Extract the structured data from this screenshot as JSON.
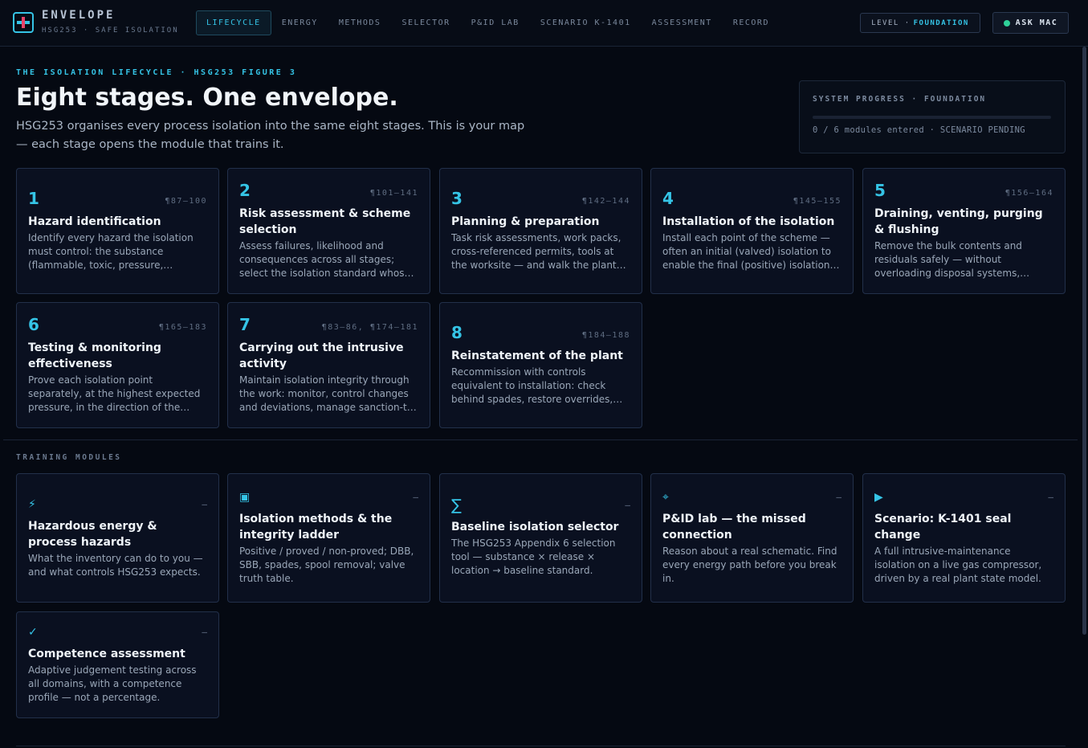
{
  "header": {
    "brand": "ENVELOPE",
    "subtitle": "HSG253 · SAFE ISOLATION",
    "nav": [
      {
        "label": "LIFECYCLE",
        "active": true
      },
      {
        "label": "ENERGY"
      },
      {
        "label": "METHODS"
      },
      {
        "label": "SELECTOR"
      },
      {
        "label": "P&ID LAB"
      },
      {
        "label": "SCENARIO K-1401"
      },
      {
        "label": "ASSESSMENT"
      },
      {
        "label": "RECORD"
      }
    ],
    "level_prefix": "LEVEL ·",
    "level_value": "FOUNDATION",
    "ask_label": "ASK MAC"
  },
  "hero": {
    "eyebrow": "THE ISOLATION LIFECYCLE · HSG253 FIGURE 3",
    "title": "Eight stages. One envelope.",
    "description": "HSG253 organises every process isolation into the same eight stages. This is your map — each stage opens the module that trains it."
  },
  "progress": {
    "title": "SYSTEM PROGRESS · FOUNDATION",
    "fraction": 0,
    "status": "0 / 6 modules entered · SCENARIO PENDING"
  },
  "stages": [
    {
      "num": "1",
      "ref": "¶87–100",
      "title": "Hazard identification",
      "desc": "Identify every hazard the isolation must control: the substance (flammable, toxic, pressure, temperature) and the stored energy."
    },
    {
      "num": "2",
      "ref": "¶101–141",
      "title": "Risk assessment & scheme selection",
      "desc": "Assess failures, likelihood and consequences across all stages; select the isolation standard whose integrity matches the risk."
    },
    {
      "num": "3",
      "ref": "¶142–144",
      "title": "Planning & preparation",
      "desc": "Task risk assessments, work packs, cross-referenced permits, tools at the worksite — and walk the plant again before you start."
    },
    {
      "num": "4",
      "ref": "¶145–155",
      "title": "Installation of the isolation",
      "desc": "Install each point of the scheme — often an initial (valved) isolation to enable the final (positive) isolation. Lock and tag."
    },
    {
      "num": "5",
      "ref": "¶156–164",
      "title": "Draining, venting, purging & flushing",
      "desc": "Remove the bulk contents and residuals safely — without overloading disposal systems, pulling vacuum or creating new hazards."
    },
    {
      "num": "6",
      "ref": "¶165–183",
      "title": "Testing & monitoring effectiveness",
      "desc": "Prove each isolation point separately, at the highest expected pressure, in the direction of the expected flow — and keep monitoring."
    },
    {
      "num": "7",
      "ref": "¶83–86, ¶174–181",
      "title": "Carrying out the intrusive activity",
      "desc": "Maintain isolation integrity through the work: monitor, control changes and deviations, manage sanction-to-test and handovers."
    },
    {
      "num": "8",
      "ref": "¶184–188",
      "title": "Reinstatement of the plant",
      "desc": "Recommission with controls equivalent to installation: check behind spades, restore overrides, leak test and hand back."
    }
  ],
  "modules_label": "TRAINING MODULES",
  "modules": [
    {
      "icon": "⚡",
      "icon_name": "lightning-icon",
      "status": "–",
      "title": "Hazardous energy & process hazards",
      "desc": "What the inventory can do to you — and what controls HSG253 expects."
    },
    {
      "icon": "▣",
      "icon_name": "square-icon",
      "status": "–",
      "title": "Isolation methods & the integrity ladder",
      "desc": "Positive / proved / non-proved; DBB, SBB, spades, spool removal; valve truth table."
    },
    {
      "icon": "∑",
      "icon_name": "sigma-icon",
      "status": "–",
      "title": "Baseline isolation selector",
      "desc": "The HSG253 Appendix 6 selection tool — substance × release × location → baseline standard."
    },
    {
      "icon": "⌖",
      "icon_name": "crosshair-icon",
      "status": "–",
      "title": "P&ID lab — the missed connection",
      "desc": "Reason about a real schematic. Find every energy path before you break in."
    },
    {
      "icon": "▶",
      "icon_name": "play-icon",
      "status": "–",
      "title": "Scenario: K-1401 seal change",
      "desc": "A full intrusive-maintenance isolation on a live gas compressor, driven by a real plant state model."
    },
    {
      "icon": "✓",
      "icon_name": "check-icon",
      "status": "–",
      "title": "Competence assessment",
      "desc": "Adaptive judgement testing across all domains, with a competence profile — not a percentage."
    }
  ]
}
